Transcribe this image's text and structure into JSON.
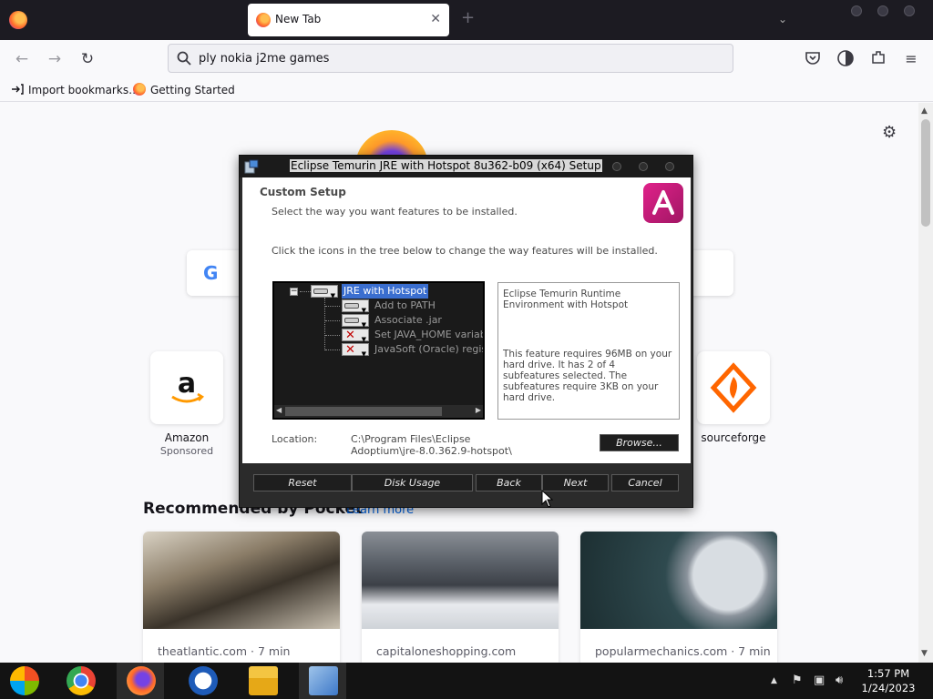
{
  "browser": {
    "tab_title": "New Tab",
    "tab_close": "✕",
    "new_tab": "+",
    "url_value": "ply nokia j2me games",
    "bookmarks": [
      "Import bookmarks…",
      "Getting Started"
    ]
  },
  "newtab": {
    "shortcuts": [
      {
        "label": "Amazon",
        "sub": "Sponsored",
        "icon": "amazon-icon"
      },
      {
        "label": "sourceforge",
        "sub": "",
        "icon": "sourceforge-icon"
      }
    ],
    "pocket_title": "Recommended by Pocket",
    "pocket_link": "Learn more",
    "cards": [
      {
        "source": "theatlantic.com · 7 min"
      },
      {
        "source": "capitaloneshopping.com"
      },
      {
        "source": "popularmechanics.com · 7 min"
      }
    ]
  },
  "dialog": {
    "title": "Eclipse Temurin JRE with Hotspot 8u362-b09 (x64) Setup",
    "header_title": "Custom Setup",
    "header_sub": "Select the way you want features to be installed.",
    "instructions": "Click the icons in the tree below to change the way features will be installed.",
    "tree": [
      {
        "label": "JRE with Hotspot",
        "state": "install",
        "selected": true
      },
      {
        "label": "Add to PATH",
        "state": "install",
        "selected": false
      },
      {
        "label": "Associate .jar",
        "state": "install",
        "selected": false
      },
      {
        "label": "Set JAVA_HOME variable",
        "state": "excluded",
        "selected": false
      },
      {
        "label": "JavaSoft (Oracle) registry keys",
        "state": "excluded",
        "selected": false
      }
    ],
    "description_1": "Eclipse Temurin Runtime Environment with Hotspot",
    "description_2": "This feature requires 96MB on your hard drive. It has 2 of 4 subfeatures selected. The subfeatures require 3KB on your hard drive.",
    "location_label": "Location:",
    "location_path": "C:\\Program Files\\Eclipse Adoptium\\jre-8.0.362.9-hotspot\\",
    "buttons": {
      "browse": "Browse...",
      "reset": "Reset",
      "disk_usage": "Disk Usage",
      "back": "Back",
      "next": "Next",
      "cancel": "Cancel"
    }
  },
  "taskbar": {
    "time": "1:57 PM",
    "date": "1/24/2023",
    "tray_chevron": "▲"
  },
  "colors": {
    "accent": "#3a6ecf",
    "excluded_x": "#c00000",
    "link": "#0061e0"
  }
}
